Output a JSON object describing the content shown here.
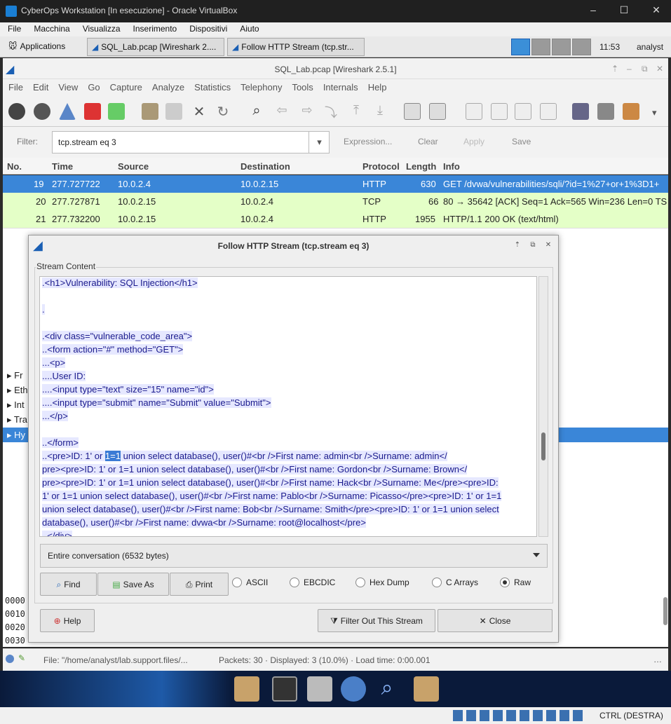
{
  "vbox": {
    "title": "CyberOps Workstation [In esecuzione] - Oracle VirtualBox",
    "menu": [
      "File",
      "Macchina",
      "Visualizza",
      "Inserimento",
      "Dispositivi",
      "Aiuto"
    ],
    "status_host_key": "CTRL (DESTRA)"
  },
  "panel": {
    "applications": "Applications",
    "tasks": [
      "SQL_Lab.pcap [Wireshark 2....",
      "Follow HTTP Stream (tcp.str..."
    ],
    "clock": "11:53",
    "user": "analyst"
  },
  "wireshark": {
    "title": "SQL_Lab.pcap [Wireshark 2.5.1]",
    "menu": [
      "File",
      "Edit",
      "View",
      "Go",
      "Capture",
      "Analyze",
      "Statistics",
      "Telephony",
      "Tools",
      "Internals",
      "Help"
    ],
    "filter": {
      "label": "Filter:",
      "value": "tcp.stream eq 3",
      "expression": "Expression...",
      "clear": "Clear",
      "apply": "Apply",
      "save": "Save"
    },
    "columns": [
      "No.",
      "Time",
      "Source",
      "Destination",
      "Protocol",
      "Length",
      "Info"
    ],
    "packets": [
      {
        "no": "19",
        "time": "277.727722",
        "src": "10.0.2.4",
        "dst": "10.0.2.15",
        "proto": "HTTP",
        "len": "630",
        "info": "GET /dvwa/vulnerabilities/sqli/?id=1%27+or+1%3D1+"
      },
      {
        "no": "20",
        "time": "277.727871",
        "src": "10.0.2.15",
        "dst": "10.0.2.4",
        "proto": "TCP",
        "len": "66",
        "info": "80 → 35642 [ACK] Seq=1 Ack=565 Win=236 Len=0 TS"
      },
      {
        "no": "21",
        "time": "277.732200",
        "src": "10.0.2.15",
        "dst": "10.0.2.4",
        "proto": "HTTP",
        "len": "1955",
        "info": "HTTP/1.1 200 OK  (text/html)"
      }
    ],
    "tree_items": [
      "Fr",
      "Eth",
      "Int",
      "Tra",
      "Hy"
    ],
    "hex_offsets": [
      "0000",
      "0010",
      "0020",
      "0030"
    ],
    "status": {
      "file": "File: \"/home/analyst/lab.support.files/...",
      "packets": "Packets: 30 · Displayed: 3 (10.0%) · Load time: 0:00.001"
    }
  },
  "dialog": {
    "title": "Follow HTTP Stream (tcp.stream eq 3)",
    "stream_label": "Stream Content",
    "lines": [
      ".<h1>Vulnerability: SQL Injection</h1>",
      "",
      ".",
      "",
      ".<div class=\"vulnerable_code_area\">",
      "..<form action=\"#\" method=\"GET\">",
      "...<p>",
      "....User ID:",
      "....<input type=\"text\" size=\"15\" name=\"id\">",
      "....<input type=\"submit\" name=\"Submit\" value=\"Submit\">",
      "...</p>",
      "",
      "..</form>",
      "",
      "pre><pre>ID: 1' or 1=1 union select database(), user()#<br />First name: Gordon<br />Surname: Brown</",
      "pre><pre>ID: 1' or 1=1 union select database(), user()#<br />First name: Hack<br />Surname: Me</pre><pre>ID:",
      "1' or 1=1 union select database(), user()#<br />First name: Pablo<br />Surname: Picasso</pre><pre>ID: 1' or 1=1",
      "union select database(), user()#<br />First name: Bob<br />Surname: Smith</pre><pre>ID: 1' or 1=1 union select",
      "database(), user()#<br />First name: dvwa<br />Surname: root@localhost</pre>",
      "..</div>"
    ],
    "line14_pre": "..<pre>ID: 1' or ",
    "line14_sel": "1=1",
    "line14_post": " union select database(), user()#<br />First name: admin<br />Surname: admin</",
    "conversation": "Entire conversation (6532 bytes)",
    "find": "Find",
    "save_as": "Save As",
    "print": "Print",
    "formats": [
      "ASCII",
      "EBCDIC",
      "Hex Dump",
      "C Arrays",
      "Raw"
    ],
    "selected_format": "Raw",
    "help": "Help",
    "filter_out": "Filter Out This Stream",
    "close": "Close"
  }
}
